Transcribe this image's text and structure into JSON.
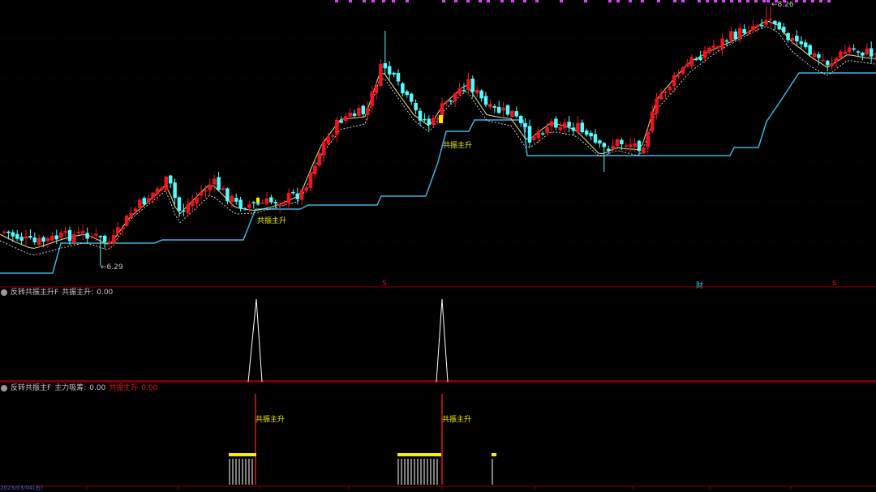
{
  "colors": {
    "up": "#f0141e",
    "down": "#54fcfc",
    "support_line": "#3cb4e6",
    "ma_short": "#f0e68c",
    "ma_long": "#ffffff",
    "signal": "#f0f000",
    "separator": "#8b0000",
    "marker_magenta": "#e040fb",
    "spike": "#ffffff",
    "red_line": "#e0141e"
  },
  "price_pane": {
    "high_label": "8.26",
    "low_label": "6.29",
    "signal_label": "共振主升",
    "event_markers": [
      "S",
      "财",
      "S"
    ]
  },
  "indicator1": {
    "name": "反转共振主升F",
    "value_label": "共振主升:",
    "value": "0.00"
  },
  "indicator2": {
    "name": "反转共振主F",
    "value_label": "主力吸筹:",
    "value": "0.00",
    "red_label": "共振主升",
    "red_value": "0.00",
    "signal_label": "共振主升"
  },
  "date_axis": {
    "start_label": "2023/03/04(五)"
  }
}
